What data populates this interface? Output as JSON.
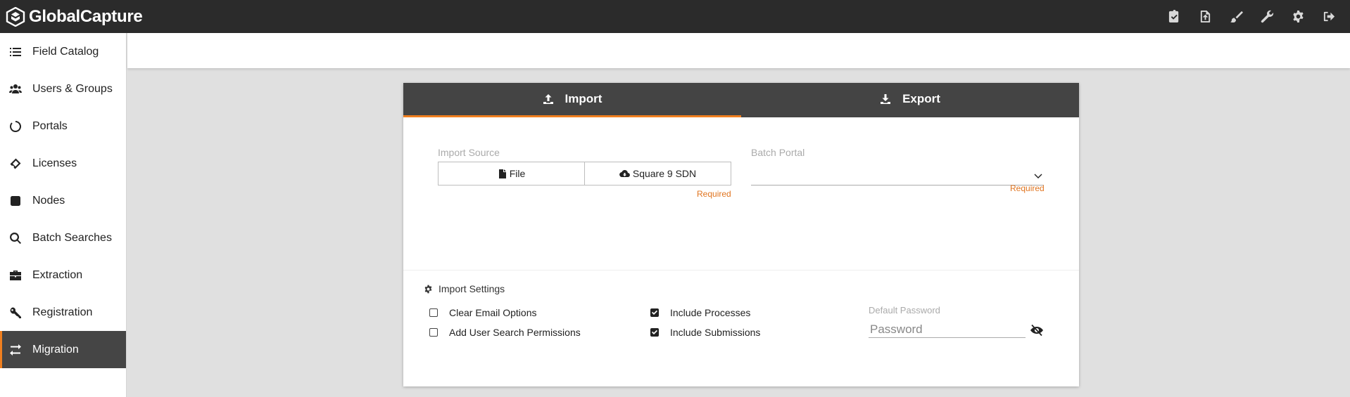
{
  "app": {
    "name": "GlobalCapture",
    "brand_accent": "#f07f1f"
  },
  "topbar": {
    "icons": [
      "clipboard-check-icon",
      "file-upload-icon",
      "brush-icon",
      "wrench-icon",
      "gear-icon",
      "sign-out-icon"
    ]
  },
  "sidebar": {
    "items": [
      {
        "label": "Field Catalog",
        "icon": "list-icon"
      },
      {
        "label": "Users & Groups",
        "icon": "users-icon"
      },
      {
        "label": "Portals",
        "icon": "portal-ring-icon"
      },
      {
        "label": "Licenses",
        "icon": "ticket-icon"
      },
      {
        "label": "Nodes",
        "icon": "square-icon"
      },
      {
        "label": "Batch Searches",
        "icon": "search-icon"
      },
      {
        "label": "Extraction",
        "icon": "briefcase-icon"
      },
      {
        "label": "Registration",
        "icon": "key-icon"
      },
      {
        "label": "Migration",
        "icon": "exchange-icon",
        "active": true
      }
    ]
  },
  "tabs": {
    "import": "Import",
    "export": "Export",
    "active": "Import"
  },
  "import_form": {
    "source_label": "Import Source",
    "file_button": "File",
    "sdn_button": "Square 9 SDN",
    "source_required": "Required",
    "portal_label": "Batch Portal",
    "portal_value": "",
    "portal_required": "Required"
  },
  "settings": {
    "title": "Import Settings",
    "clear_email": {
      "label": "Clear Email Options",
      "checked": false
    },
    "add_user_search": {
      "label": "Add User Search Permissions",
      "checked": false
    },
    "include_processes": {
      "label": "Include Processes",
      "checked": true
    },
    "include_submissions": {
      "label": "Include Submissions",
      "checked": true
    },
    "password_label": "Default Password",
    "password_placeholder": "Password"
  }
}
